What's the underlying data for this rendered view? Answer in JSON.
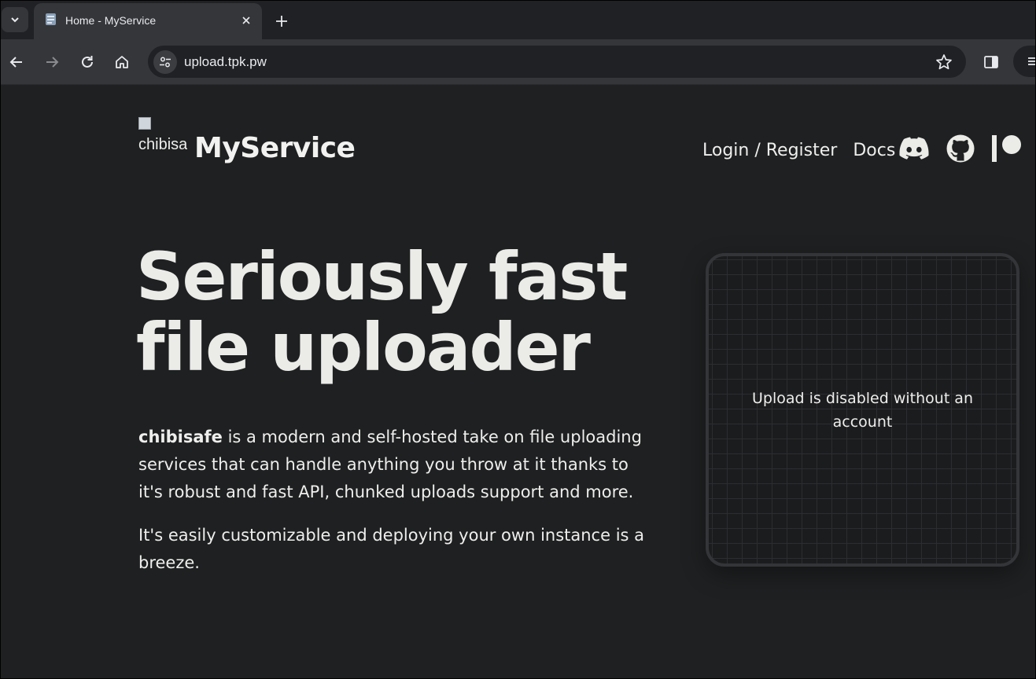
{
  "browser": {
    "tab": {
      "title": "Home - MyService"
    },
    "address_bar": {
      "url": "upload.tpk.pw"
    },
    "icons": {
      "tab_search": "chevron-down-icon",
      "close_tab": "close-icon",
      "new_tab": "plus-icon",
      "back": "arrow-left-icon",
      "forward": "arrow-right-icon",
      "reload": "reload-icon",
      "home": "home-icon",
      "site_info": "tune-icon",
      "bookmark": "star-icon",
      "side_panel": "side-panel-icon",
      "extensions": "extensions-icon"
    }
  },
  "header": {
    "logo_alt": "chibisafe logo",
    "brand": "MyService",
    "nav": {
      "login": "Login / Register",
      "docs": "Docs"
    },
    "social_icons": [
      "discord-icon",
      "github-icon",
      "patreon-icon"
    ]
  },
  "hero": {
    "title": "Seriously fast file uploader",
    "description_bold": "chibisafe",
    "description_rest": " is a modern and self-hosted take on file uploading services that can handle anything you throw at it thanks to it's robust and fast API, chunked uploads support and more.",
    "description2": "It's easily customizable and deploying your own instance is a breeze."
  },
  "upload": {
    "message": "Upload is disabled without an account"
  },
  "colors": {
    "page_background": "#1e2021",
    "text": "#eeeeec",
    "toolbar": "#35363a",
    "tabstrip": "#202124",
    "upload_border": "#333538"
  }
}
